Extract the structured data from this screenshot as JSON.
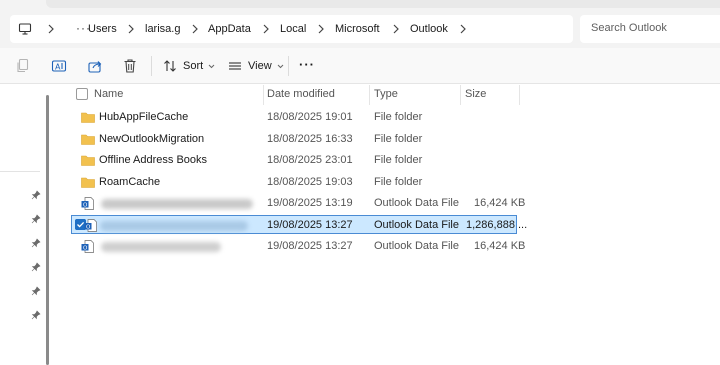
{
  "address_bar": {
    "overflow": "···",
    "breadcrumbs": [
      "Users",
      "larisa.g",
      "AppData",
      "Local",
      "Microsoft",
      "Outlook"
    ]
  },
  "search": {
    "placeholder": "Search Outlook"
  },
  "toolbar": {
    "sort_label": "Sort",
    "view_label": "View",
    "more_label": "···"
  },
  "columns": {
    "name": "Name",
    "date_modified": "Date modified",
    "type": "Type",
    "size": "Size"
  },
  "files": [
    {
      "name": "HubAppFileCache",
      "date": "18/08/2025 19:01",
      "type": "File folder",
      "size": "",
      "icon": "folder-icon"
    },
    {
      "name": "NewOutlookMigration",
      "date": "18/08/2025 16:33",
      "type": "File folder",
      "size": "",
      "icon": "folder-icon"
    },
    {
      "name": "Offline Address Books",
      "date": "18/08/2025 23:01",
      "type": "File folder",
      "size": "",
      "icon": "folder-icon"
    },
    {
      "name": "RoamCache",
      "date": "18/08/2025 19:03",
      "type": "File folder",
      "size": "",
      "icon": "folder-icon"
    },
    {
      "name": "",
      "date": "19/08/2025 13:19",
      "type": "Outlook Data File",
      "size": "16,424 KB",
      "icon": "outlook-data-file-icon"
    },
    {
      "name": "",
      "date": "19/08/2025 13:27",
      "type": "Outlook Data File",
      "size": "1,286,888 ...",
      "icon": "outlook-data-file-icon"
    },
    {
      "name": "",
      "date": "19/08/2025 13:27",
      "type": "Outlook Data File",
      "size": "16,424 KB",
      "icon": "outlook-data-file-icon"
    }
  ],
  "colors": {
    "selection_bg": "#cce8ff",
    "selection_border": "#4a8bd4",
    "folder": "#f2c14e",
    "accent": "#1f6fc5"
  }
}
